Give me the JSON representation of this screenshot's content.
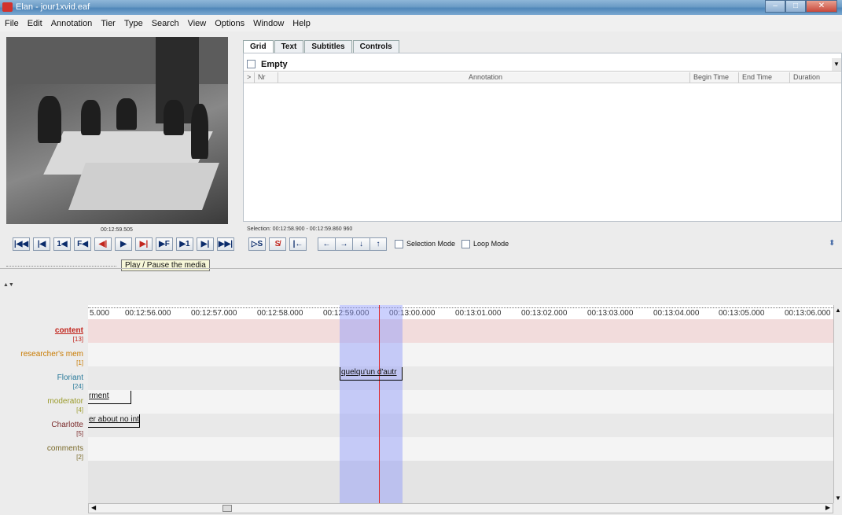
{
  "window": {
    "title": "Elan - jour1xvid.eaf"
  },
  "menu": [
    "File",
    "Edit",
    "Annotation",
    "Tier",
    "Type",
    "Search",
    "View",
    "Options",
    "Window",
    "Help"
  ],
  "video": {
    "timecode": "00:12:59.505"
  },
  "player_buttons": [
    "|◀◀",
    "|◀",
    "1◀",
    "F◀",
    "◀|",
    "▶",
    "▶|",
    "▶F",
    "▶1",
    "▶|",
    "▶▶|"
  ],
  "selection_buttons": [
    "▷S",
    "S̸",
    "|←"
  ],
  "nav_buttons": [
    "←",
    "→",
    "↓",
    "↑"
  ],
  "checkboxes": {
    "selection_mode": "Selection Mode",
    "loop_mode": "Loop Mode"
  },
  "tabs": [
    "Grid",
    "Text",
    "Subtitles",
    "Controls"
  ],
  "grid": {
    "tier": "Empty",
    "columns": [
      ">",
      "Nr",
      "Annotation",
      "Begin Time",
      "End Time",
      "Duration"
    ]
  },
  "selection_text": "Selection: 00:12:58.900 - 00:12:59.860  960",
  "tooltip": "Play / Pause the media",
  "ruler_ticks": [
    "5.000",
    "00:12:56.000",
    "00:12:57.000",
    "00:12:58.000",
    "00:12:59.000",
    "00:13:00.000",
    "00:13:01.000",
    "00:13:02.000",
    "00:13:03.000",
    "00:13:04.000",
    "00:13:05.000",
    "00:13:06.000"
  ],
  "tiers": [
    {
      "name": "content",
      "count": "[13]",
      "color": "#c2261e"
    },
    {
      "name": "researcher's mem",
      "count": "[1]",
      "color": "#c87a00"
    },
    {
      "name": "Floriant",
      "count": "[24]",
      "color": "#2a7a9a"
    },
    {
      "name": "moderator",
      "count": "[4]",
      "color": "#9a9a2a"
    },
    {
      "name": "Charlotte",
      "count": "[5]",
      "color": "#7a2a2a"
    },
    {
      "name": "comments",
      "count": "[2]",
      "color": "#7a6a2a"
    }
  ],
  "annotations": {
    "moderator": "quelqu'un d'autr",
    "charlotte": "rment",
    "comments": "er about no int"
  }
}
